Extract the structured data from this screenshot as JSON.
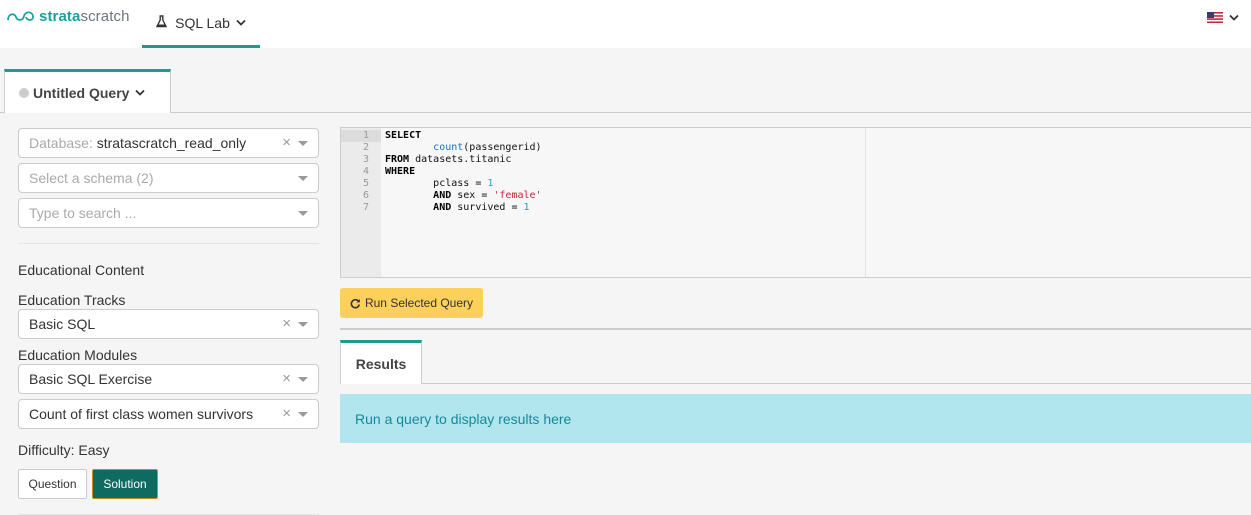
{
  "nav": {
    "brand_a": "strata",
    "brand_b": "scratch",
    "tab_label": "SQL Lab"
  },
  "query_tab": {
    "title": "Untitled Query"
  },
  "left": {
    "database_prefix": "Database:",
    "database_value": "stratascratch_read_only",
    "schema_placeholder": "Select a schema (2)",
    "search_placeholder": "Type to search ...",
    "edu_content": "Educational Content",
    "tracks_label": "Education Tracks",
    "tracks_value": "Basic SQL",
    "modules_label": "Education Modules",
    "modules_value": "Basic SQL Exercise",
    "question_value": "Count of first class women survivors",
    "difficulty": "Difficulty: Easy",
    "question_btn": "Question",
    "solution_btn": "Solution"
  },
  "editor": {
    "line_numbers": [
      "1",
      "2",
      "3",
      "4",
      "5",
      "6",
      "7"
    ],
    "l1_kw": "SELECT",
    "l2_indent": "        ",
    "l2_fn": "count",
    "l2_rest": "(passengerid)",
    "l3_kw": "FROM",
    "l3_rest": " datasets.titanic",
    "l4_kw": "WHERE",
    "l5_indent": "        ",
    "l5_a": "pclass = ",
    "l5_num": "1",
    "l6_indent": "        ",
    "l6_kw": "AND",
    "l6_a": " sex = ",
    "l6_str": "'female'",
    "l7_indent": "        ",
    "l7_kw": "AND",
    "l7_a": " survived = ",
    "l7_num": "1"
  },
  "run_button": "Run Selected Query",
  "results": {
    "tab": "Results",
    "message": "Run a query to display results here"
  },
  "colors": {
    "accent": "#1a9c91",
    "run_button": "#fcd05b",
    "solution_button": "#0f6b62",
    "alert_bg": "#b1e6ef",
    "alert_text": "#17889b"
  },
  "icons": [
    "stratascratch-logo-icon",
    "flask-icon",
    "chevron-down-icon",
    "us-flag-icon",
    "refresh-icon"
  ]
}
